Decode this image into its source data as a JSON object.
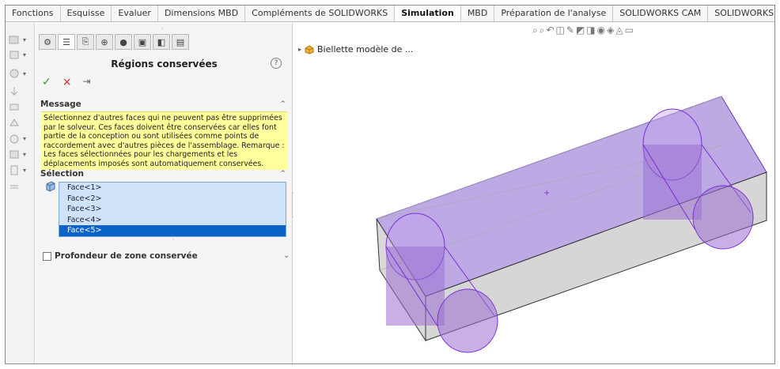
{
  "ribbon": {
    "tabs": [
      {
        "label": "Fonctions"
      },
      {
        "label": "Esquisse"
      },
      {
        "label": "Evaluer"
      },
      {
        "label": "Dimensions MBD"
      },
      {
        "label": "Compléments de SOLIDWORKS"
      },
      {
        "label": "Simulation",
        "active": true
      },
      {
        "label": "MBD"
      },
      {
        "label": "Préparation de l'analyse"
      },
      {
        "label": "SOLIDWORKS CAM"
      },
      {
        "label": "SOLIDWORKS CAM TBM"
      }
    ]
  },
  "property_manager": {
    "title": "Régions conservées",
    "help": "?",
    "actions": {
      "ok": "✓",
      "cancel": "×",
      "pin": "⇥"
    },
    "message": {
      "header": "Message",
      "text": "Sélectionnez d'autres faces qui ne peuvent pas être supprimées par le solveur. Ces faces doivent être conservées car elles font partie de la conception ou sont utilisées comme points de raccordement avec d'autres pièces de l'assemblage.\n Remarque : Les faces sélectionnées pour les chargements et les déplacements imposés sont automatiquement conservées."
    },
    "selection": {
      "header": "Sélection",
      "items": [
        "Face<1>",
        "Face<2>",
        "Face<3>",
        "Face<4>",
        "Face<5>"
      ],
      "selected_index": 4
    },
    "depth_option": {
      "label": "Profondeur de zone conservée",
      "checked": false
    }
  },
  "graphics": {
    "tree_item": "Biellette modèle de ..."
  },
  "colors": {
    "message_bg": "#ffff9b",
    "selection_bg": "#cfe3f8",
    "selected_row": "#0a64c8",
    "highlight": "#9b6fd1"
  }
}
